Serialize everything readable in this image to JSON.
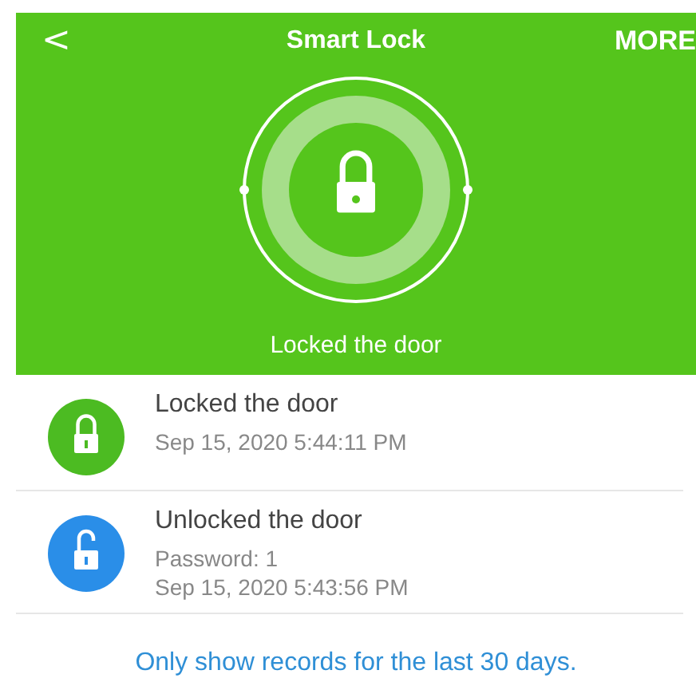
{
  "header": {
    "back": "<",
    "title": "Smart Lock",
    "action": "MORE"
  },
  "lock": {
    "locked": true,
    "status": "Locked the door"
  },
  "records": [
    {
      "kind": "locked",
      "title": "Locked the door",
      "details": [
        "Sep 15, 2020 5:44:11 PM"
      ]
    },
    {
      "kind": "unlocked",
      "title": "Unlocked the door",
      "details": [
        "Password: 1",
        "Sep 15, 2020 5:43:56 PM"
      ]
    }
  ],
  "footer": "Only show records for the last 30 days."
}
